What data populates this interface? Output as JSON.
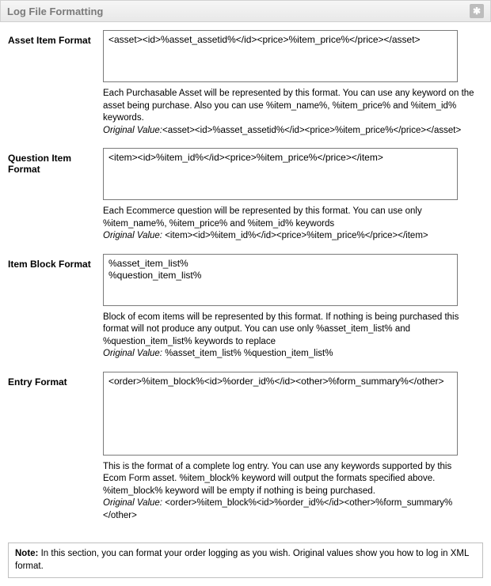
{
  "header": {
    "title": "Log File Formatting",
    "star_icon": "✱"
  },
  "fields": {
    "asset": {
      "label": "Asset Item Format",
      "value": "<asset><id>%asset_assetid%</id><price>%item_price%</price></asset>",
      "help": "Each Purchasable Asset will be represented by this format. You can use any keyword on the asset being purchase. Also you can use %item_name%, %item_price% and %item_id% keywords.",
      "original_label": "Original Value:",
      "original_value": "<asset><id>%asset_assetid%</id><price>%item_price%</price></asset>"
    },
    "question": {
      "label": "Question Item Format",
      "value": "<item><id>%item_id%</id><price>%item_price%</price></item>",
      "help": "Each Ecommerce question will be represented by this format. You can use only %item_name%, %item_price% and %item_id% keywords",
      "original_label": "Original Value:",
      "original_value": " <item><id>%item_id%</id><price>%item_price%</price></item>"
    },
    "itemblock": {
      "label": "Item Block Format",
      "value": "%asset_item_list%\n%question_item_list%",
      "help": "Block of ecom items will be represented by this format. If nothing is being purchased this format will not produce any output. You can use only %asset_item_list% and %question_item_list% keywords to replace",
      "original_label": "Original Value:",
      "original_value": " %asset_item_list% %question_item_list%"
    },
    "entry": {
      "label": "Entry Format",
      "value": "<order>%item_block%<id>%order_id%</id><other>%form_summary%</other>",
      "help": "This is the format of a complete log entry. You can use any keywords supported by this Ecom Form asset. %item_block% keyword will output the formats specified above. %item_block% keyword will be empty if nothing is being purchased.",
      "original_label": "Original Value:",
      "original_value": " <order>%item_block%<id>%order_id%</id><other>%form_summary%</other>"
    }
  },
  "note": {
    "label": "Note:",
    "text": " In this section, you can format your order logging as you wish. Original values show you how to log in XML format."
  }
}
